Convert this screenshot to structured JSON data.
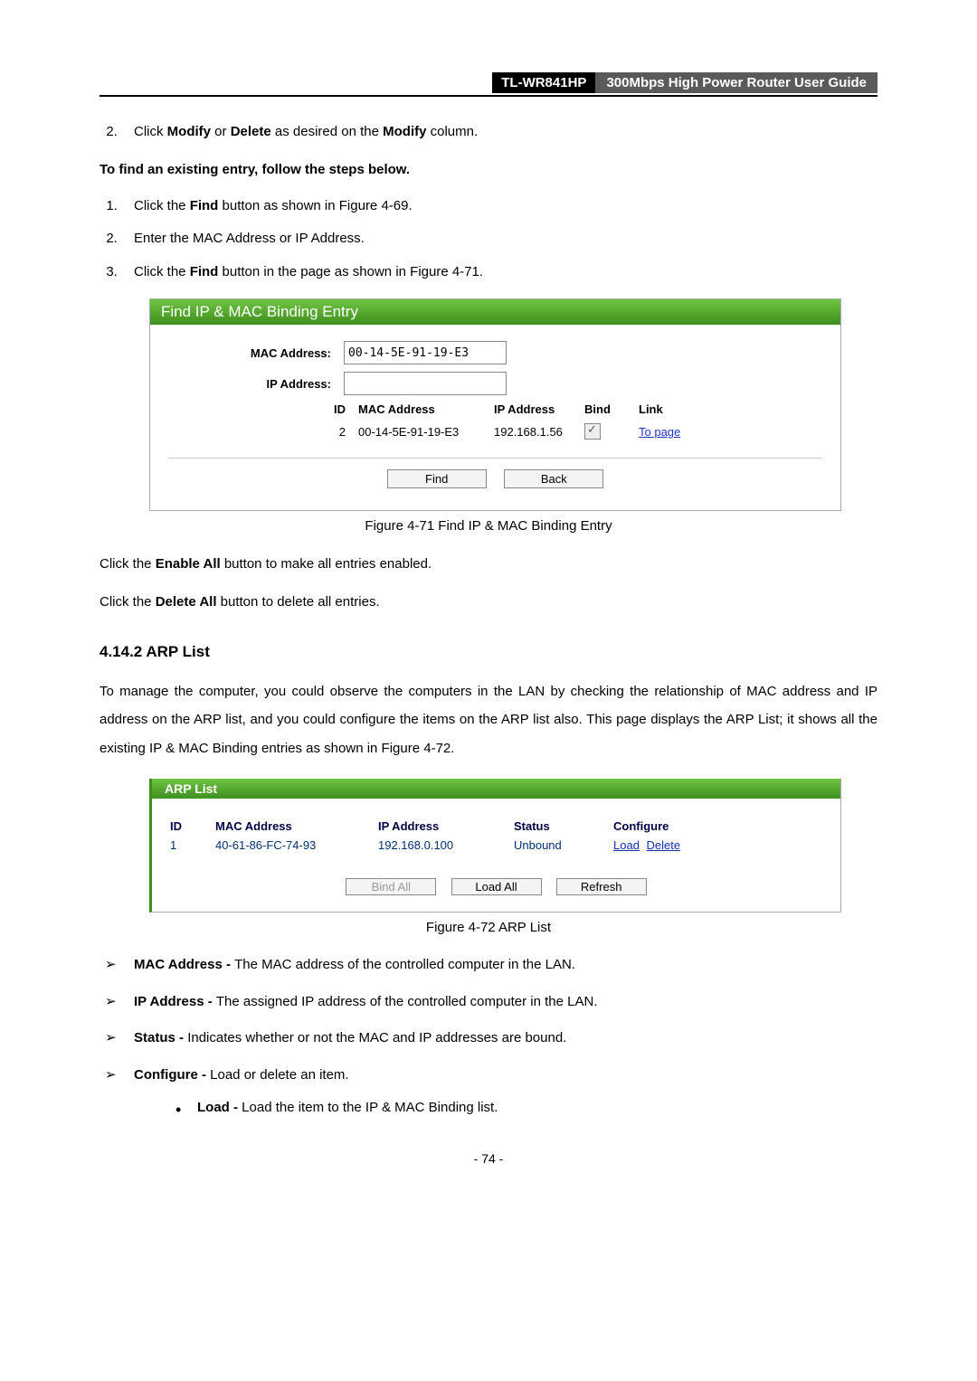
{
  "header": {
    "model": "TL-WR841HP",
    "title": "300Mbps High Power Router User Guide"
  },
  "list1": {
    "start": 2,
    "item2_pre": "Click ",
    "item2_b1": "Modify",
    "item2_mid": " or ",
    "item2_b2": "Delete",
    "item2_mid2": " as desired on the ",
    "item2_b3": "Modify",
    "item2_post": " column."
  },
  "steps_heading": "To find an existing entry, follow the steps below.",
  "steps": {
    "s1_pre": "Click the ",
    "s1_b": "Find",
    "s1_post": " button as shown in Figure 4-69.",
    "s2": "Enter the MAC Address or IP Address.",
    "s3_pre": "Click the ",
    "s3_b": "Find",
    "s3_post": " button in the page as shown in Figure 4-71."
  },
  "panel1": {
    "title": "Find IP & MAC Binding Entry",
    "mac_label": "MAC Address:",
    "mac_value": "00-14-5E-91-19-E3",
    "ip_label": "IP Address:",
    "ip_value": "",
    "th_id": "ID",
    "th_mac": "MAC Address",
    "th_ip": "IP Address",
    "th_bind": "Bind",
    "th_link": "Link",
    "row_id": "2",
    "row_mac": "00-14-5E-91-19-E3",
    "row_ip": "192.168.1.56",
    "row_link": "To page",
    "btn_find": "Find",
    "btn_back": "Back"
  },
  "caption1": "Figure 4-71 Find IP & MAC Binding Entry",
  "para1_pre": "Click the ",
  "para1_b": "Enable All",
  "para1_post": " button to make all entries enabled.",
  "para2_pre": "Click the ",
  "para2_b": "Delete All",
  "para2_post": " button to delete all entries.",
  "section_h": "4.14.2 ARP List",
  "arp_intro": "To manage the computer, you could observe the computers in the LAN by checking the relationship of MAC address and IP address on the ARP list, and you could configure the items on the ARP list also. This page displays the ARP List; it shows all the existing IP & MAC Binding entries as shown in Figure 4-72.",
  "panel2": {
    "title": "ARP List",
    "h_id": "ID",
    "h_mac": "MAC Address",
    "h_ip": "IP Address",
    "h_status": "Status",
    "h_conf": "Configure",
    "r_id": "1",
    "r_mac": "40-61-86-FC-74-93",
    "r_ip": "192.168.0.100",
    "r_status": "Unbound",
    "r_load": "Load",
    "r_delete": "Delete",
    "btn_bindall": "Bind All",
    "btn_loadall": "Load All",
    "btn_refresh": "Refresh"
  },
  "caption2": "Figure 4-72   ARP List",
  "defs": {
    "mac_b": "MAC Address - ",
    "mac_t": "The MAC address of the controlled computer in the LAN.",
    "ip_b": "IP Address - ",
    "ip_t": "The assigned IP address of the controlled computer in the LAN.",
    "st_b": "Status - ",
    "st_t": "Indicates whether or not the MAC and IP addresses are bound.",
    "cf_b": "Configure - ",
    "cf_t": "Load or delete an item.",
    "ld_b": "Load - ",
    "ld_t": "Load the item to the IP & MAC Binding list."
  },
  "pageno": "- 74 -"
}
